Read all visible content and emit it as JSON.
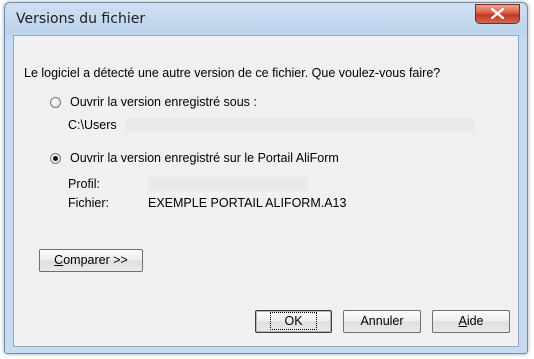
{
  "window": {
    "title": "Versions du fichier"
  },
  "dialog": {
    "question": "Le logiciel a détecté une autre version de ce fichier. Que voulez-vous faire?",
    "option_local": {
      "label": "Ouvrir la version enregistré sous :",
      "checked": false,
      "path": "C:\\Users"
    },
    "option_portal": {
      "label": "Ouvrir la version enregistré sur le Portail AliForm",
      "checked": true,
      "profile_label": "Profil:",
      "profile_value": "",
      "file_label": "Fichier:",
      "file_value": "EXEMPLE PORTAIL ALIFORM.A13"
    }
  },
  "buttons": {
    "compare_mnemonic": "C",
    "compare_rest": "omparer >>",
    "ok": "OK",
    "cancel": "Annuler",
    "help_mnemonic": "A",
    "help_rest": "ide"
  },
  "icons": {
    "close": "close-x-icon"
  },
  "colors": {
    "close_button": "#c9452b",
    "frame": "#bcd3ec",
    "client_background": "#f0f0f0"
  }
}
